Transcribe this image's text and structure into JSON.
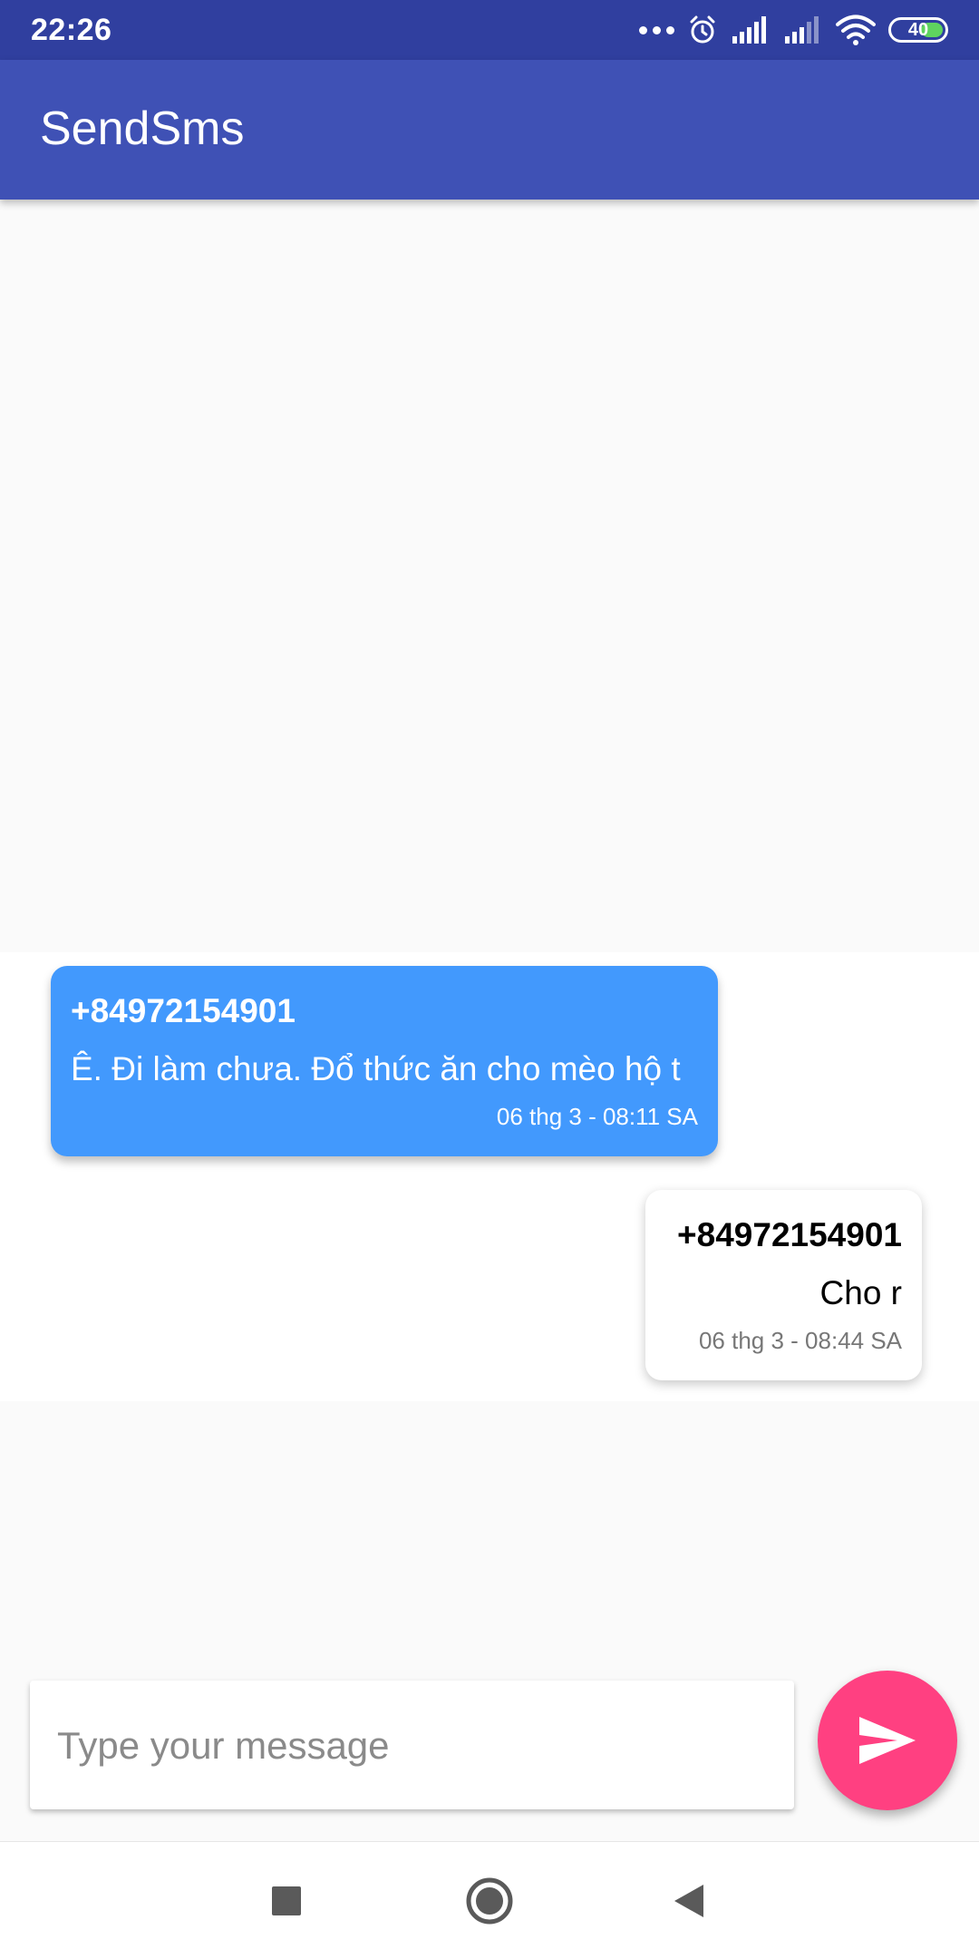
{
  "status_bar": {
    "time": "22:26",
    "battery": "40",
    "icons": [
      "more-dots-icon",
      "alarm-icon",
      "signal-1-icon",
      "signal-2-icon",
      "wifi-icon",
      "battery-icon"
    ]
  },
  "app_bar": {
    "title": "SendSms"
  },
  "messages": [
    {
      "direction": "incoming",
      "sender": "+84972154901",
      "body": "Ê. Đi làm chưa. Đổ thức ăn cho mèo hộ t",
      "time": "06 thg 3 - 08:11 SA",
      "bubble_color": "#4299fd"
    },
    {
      "direction": "outgoing",
      "sender": "+84972154901",
      "body": "Cho r",
      "time": "06 thg 3 - 08:44 SA",
      "bubble_color": "#ffffff"
    }
  ],
  "composer": {
    "placeholder": "Type your message",
    "value": "",
    "send_icon": "send-icon"
  },
  "nav_bar": {
    "icons": [
      "recents-icon",
      "home-icon",
      "back-icon"
    ]
  },
  "colors": {
    "status_bar": "#303f9f",
    "primary": "#3f51b5",
    "accent": "#ff4081",
    "incoming_bubble": "#4299fd"
  }
}
